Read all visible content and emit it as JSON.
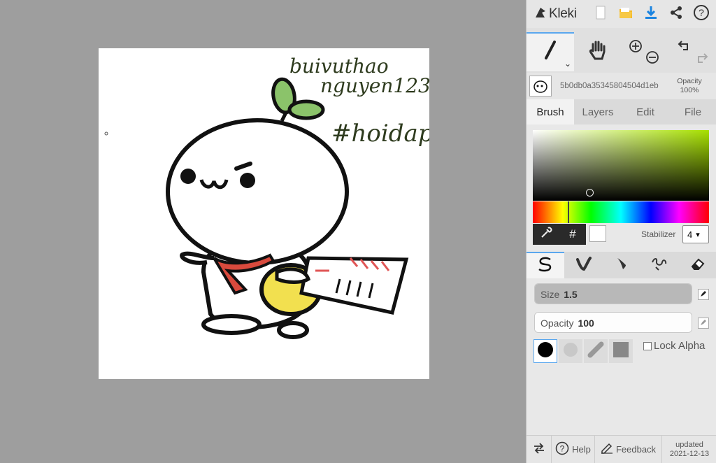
{
  "app": {
    "name": "Kleki"
  },
  "canvas": {
    "drawing_text_lines": [
      "buivuthao",
      "nguyen123",
      "#hoidap"
    ]
  },
  "layer": {
    "name": "5b0db0a35345804504d1eb",
    "opacity_label": "Opacity",
    "opacity_value": "100%"
  },
  "tabs": [
    "Brush",
    "Layers",
    "Edit",
    "File"
  ],
  "color": {
    "primary": "#ffffff",
    "sv_base": "#a7e000"
  },
  "stabilizer": {
    "label": "Stabilizer",
    "value": "4"
  },
  "hex_button": "#",
  "sliders": {
    "size": {
      "label": "Size",
      "value": "1.5",
      "fraction": 0.015
    },
    "opacity": {
      "label": "Opacity",
      "value": "100",
      "fraction": 1.0
    }
  },
  "lock_alpha": "Lock Alpha",
  "bottom": {
    "help": "Help",
    "feedback": "Feedback",
    "updated_label": "updated",
    "updated_date": "2021-12-13"
  },
  "icons": {
    "top": [
      "kleki-logo-icon",
      "new-file-icon",
      "open-folder-icon",
      "download-icon",
      "share-icon",
      "help-circle-icon"
    ],
    "tools": [
      "brush-tool-icon",
      "hand-tool-icon",
      "zoom-in-icon",
      "zoom-out-icon",
      "undo-icon",
      "redo-icon"
    ],
    "brush_types": [
      "pen-brush-icon",
      "blend-brush-icon",
      "sketchy-brush-icon",
      "pixel-brush-icon",
      "eraser-icon"
    ]
  }
}
